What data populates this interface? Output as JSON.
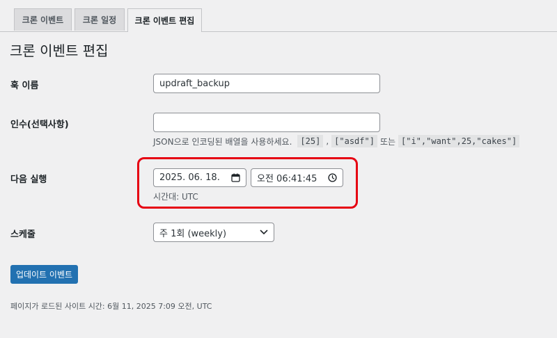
{
  "tabs": [
    {
      "label": "크론 이벤트",
      "active": false
    },
    {
      "label": "크론 일정",
      "active": false
    },
    {
      "label": "크론 이벤트 편집",
      "active": true
    }
  ],
  "page_title": "크론 이벤트 편집",
  "hook": {
    "label": "훅 이름",
    "value": "updraft_backup"
  },
  "args": {
    "label": "인수(선택사항)",
    "value": "",
    "desc_prefix": "JSON으로 인코딩된 배열을 사용하세요.",
    "example1": "[25]",
    "sep1": ",",
    "example2": "[\"asdf\"]",
    "sep2": "또는",
    "example3": "[\"i\",\"want\",25,\"cakes\"]"
  },
  "next_run": {
    "label": "다음 실행",
    "date": "2025. 06. 18.",
    "time": "오전 06:41:45",
    "timezone": "시간대: UTC"
  },
  "schedule": {
    "label": "스케줄",
    "selected": "주 1회 (weekly)"
  },
  "submit_label": "업데이트 이벤트",
  "footer": "페이지가 로드된 사이트 시간: 6월 11, 2025 7:09 오전, UTC",
  "colors": {
    "accent": "#2271b1",
    "highlight": "#e60012",
    "background": "#f0f0f1"
  },
  "icons": {
    "date": "calendar-icon",
    "time": "clock-icon",
    "select": "chevron-down-icon"
  }
}
